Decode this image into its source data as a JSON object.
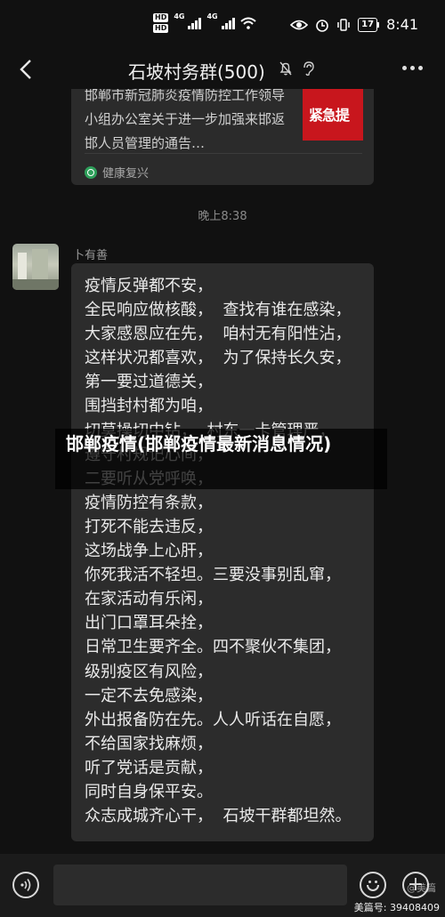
{
  "status_bar": {
    "hd_badges": [
      "HD",
      "HD"
    ],
    "signal_label_1": "4G",
    "signal_label_2": "4G",
    "battery": "17",
    "time": "8:41"
  },
  "header": {
    "title": "石坡村务群(500)",
    "back_icon": "chevron-left-icon",
    "mute_icon": "bell-off-icon",
    "ear_icon": "ear-icon",
    "more_icon": "more-dots-icon"
  },
  "shared_card": {
    "text": "邯郸市新冠肺炎疫情防控工作领导小组办公室关于进一步加强来邯返邯人员管理的通告…",
    "thumb_text": "紧急提",
    "source": "健康复兴"
  },
  "timestamp": "晚上8:38",
  "message": {
    "sender": "卜有善",
    "lines": [
      "疫情反弹都不安，",
      "全民响应做核酸，  查找有谁在感染，",
      "大家感恩应在先，  咱村无有阳性沾，",
      "这样状况都喜欢，  为了保持长久安，",
      "第一要过道德关，",
      "围挡封村都为咱，",
      "切莫操切中钻，  村东一卡管理严，",
      "遵守村规记心间，",
      "二要听从党呼唤，",
      "疫情防控有条款，",
      "打死不能去违反，",
      "这场战争上心肝，",
      "你死我活不轻坦。三要没事别乱窜，",
      "在家活动有乐闲，",
      "出门口罩耳朵拴，",
      "日常卫生要齐全。四不聚伙不集团，",
      "级别疫区有风险，",
      "一定不去免感染，",
      "外出报备防在先。人人听话在自愿，",
      "不给国家找麻烦，",
      "听了党话是贡献，",
      "同时自身保平安。",
      "众志成城齐心干，  石坡干群都坦然。"
    ]
  },
  "overlay_title": "邯郸疫情(邯郸疫情最新消息情况)",
  "bottom_bar": {
    "voice_icon": "voice-icon",
    "emoji_icon": "emoji-icon",
    "plus_icon": "plus-icon",
    "plus_glyph": "+",
    "watermark_1": "@美篇",
    "watermark_2": "美篇号: 39408409"
  }
}
